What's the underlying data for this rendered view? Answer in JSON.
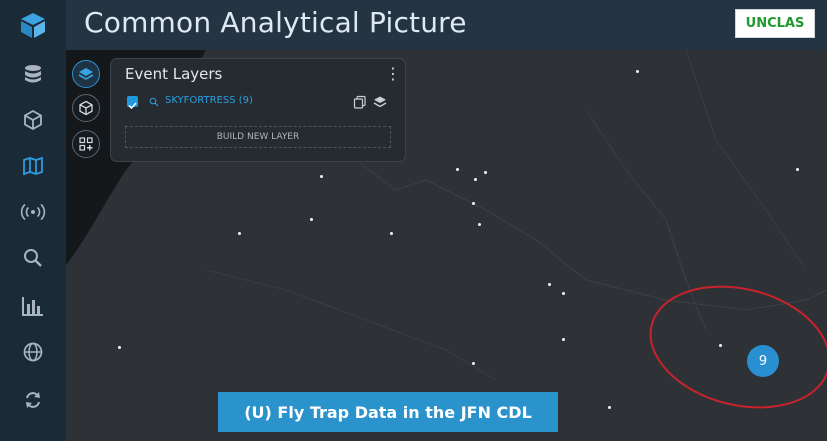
{
  "header": {
    "title": "Common Analytical Picture",
    "classification": "UNCLAS"
  },
  "sidebar": {
    "items": [
      {
        "icon": "database-icon",
        "active": false
      },
      {
        "icon": "cube-icon",
        "active": false
      },
      {
        "icon": "map-icon",
        "active": true
      },
      {
        "icon": "signal-icon",
        "active": false
      },
      {
        "icon": "search-icon",
        "active": false
      },
      {
        "icon": "bar-chart-icon",
        "active": false
      },
      {
        "icon": "globe-icon",
        "active": false
      },
      {
        "icon": "refresh-icon",
        "active": false
      }
    ]
  },
  "panel": {
    "title": "Event Layers",
    "layer": {
      "name": "SKYFORTRESS (9)",
      "checked": true
    },
    "build_button": "BUILD NEW LAYER"
  },
  "map": {
    "cities": [
      {
        "label": ""
      },
      {
        "label": ""
      },
      {
        "label": ""
      },
      {
        "label": ""
      },
      {
        "label": ""
      },
      {
        "label": ""
      },
      {
        "label": ""
      },
      {
        "label": ""
      },
      {
        "label": ""
      },
      {
        "label": ""
      },
      {
        "label": ""
      },
      {
        "label": ""
      },
      {
        "label": ""
      },
      {
        "label": ""
      },
      {
        "label": ""
      },
      {
        "label": ""
      },
      {
        "label": ""
      },
      {
        "label": ""
      }
    ],
    "cluster_count": "9"
  },
  "caption": "(U) Fly Trap Data in the JFN CDL",
  "colors": {
    "accent": "#2a8fd0",
    "annotation_ring": "#c8232c",
    "classification": "#1f9a2c"
  }
}
